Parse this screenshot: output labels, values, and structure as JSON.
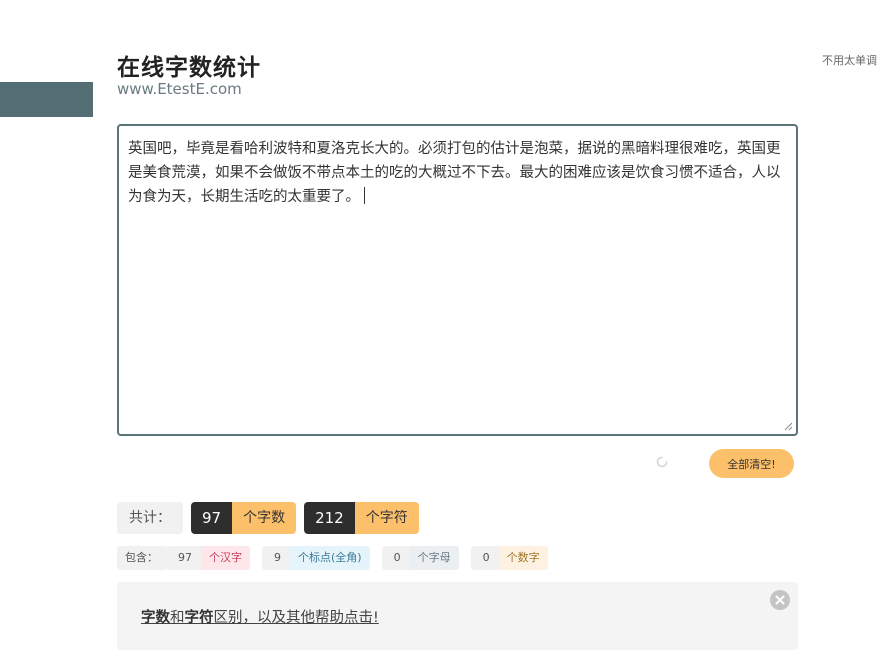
{
  "header": {
    "title": "在线字数统计",
    "site": "www.EtestE.com",
    "corner_text": "不用太单调"
  },
  "editor": {
    "value": "英国吧，毕竟是看哈利波特和夏洛克长大的。必须打包的估计是泡菜，据说的黑暗料理很难吃，英国更是美食荒漠，如果不会做饭不带点本土的吃的大概过不下去。最大的困难应该是饮食习惯不适合，人以为食为天，长期生活吃的太重要了。"
  },
  "actions": {
    "clear_label": "全部清空!"
  },
  "totals": {
    "label": "共计：",
    "chars_count": "97",
    "chars_unit": "个字数",
    "symbols_count": "212",
    "symbols_unit": "个字符"
  },
  "breakdown": {
    "label": "包含：",
    "chinese_count": "97",
    "chinese_unit": "个汉字",
    "punct_count": "9",
    "punct_unit": "个标点(全角)",
    "letter_count": "0",
    "letter_unit": "个字母",
    "digit_count": "0",
    "digit_unit": "个数字"
  },
  "help": {
    "word_a": "字数",
    "and": "和",
    "word_b": "字符",
    "rest": "区别，以及其他帮助点击!"
  },
  "colors": {
    "accent": "#fcc06a",
    "dark": "#2e2e2e",
    "sidebar": "#546e74",
    "editor_border": "#5b7478"
  },
  "icons": {
    "spinner": "loading-spinner-icon",
    "close": "close-icon",
    "resize": "resize-grip-icon"
  }
}
